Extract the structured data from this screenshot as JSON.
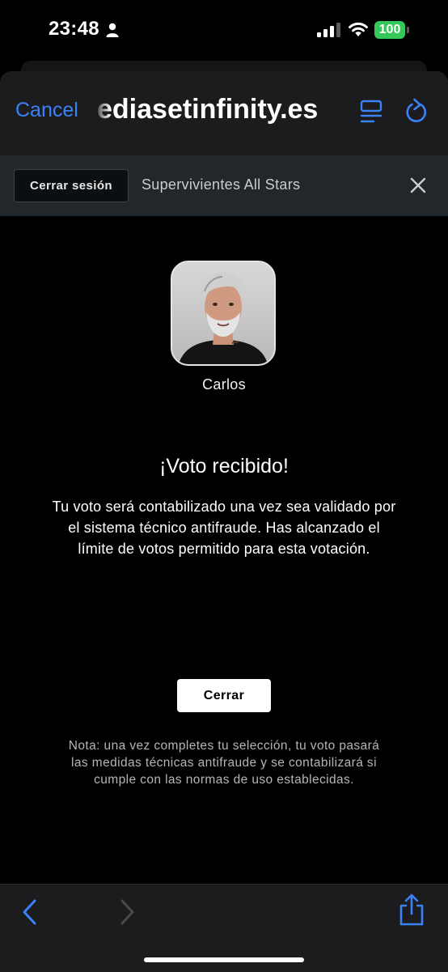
{
  "status_bar": {
    "time": "23:48",
    "battery": "100",
    "colors": {
      "battery": "#34c759"
    }
  },
  "browser": {
    "cancel_label": "Cancel",
    "url": "ediasetinfinity.es",
    "accent_color": "#3a82f7",
    "icons": [
      "reader-icon",
      "reload-icon"
    ]
  },
  "site_bar": {
    "logout_label": "Cerrar sesión",
    "title": "Supervivientes All Stars"
  },
  "candidate": {
    "name": "Carlos"
  },
  "confirmation": {
    "heading": "¡Voto recibido!",
    "message": "Tu voto será contabilizado una vez sea validado por el sistema técnico antifraude. Has alcanzado el límite de votos permitido para esta votación.",
    "close_label": "Cerrar",
    "note": "Nota: una vez completes tu selección, tu voto pasará las medidas técnicas antifraude y se contabilizará si cumple con las normas de uso establecidas."
  },
  "toolbar": {
    "icons": [
      "back-icon",
      "forward-icon",
      "share-icon"
    ]
  }
}
